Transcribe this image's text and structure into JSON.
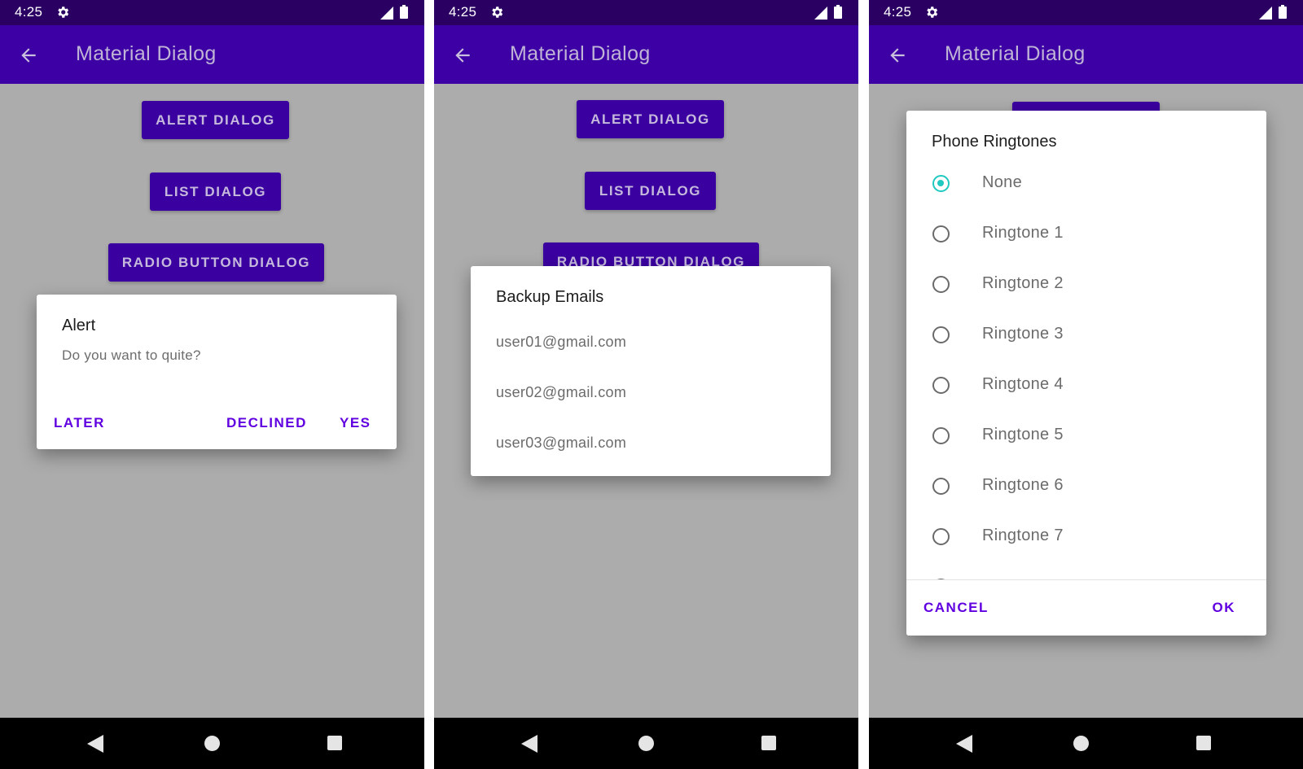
{
  "status_bar": {
    "time": "4:25"
  },
  "app_bar": {
    "title": "Material Dialog"
  },
  "buttons": {
    "alert": "ALERT DIALOG",
    "list": "LIST DIALOG",
    "radio": "RADIO BUTTON DIALOG"
  },
  "alert_dialog": {
    "title": "Alert",
    "message": "Do you want to quite?",
    "actions": {
      "later": "LATER",
      "declined": "DECLINED",
      "yes": "YES"
    }
  },
  "list_dialog": {
    "title": "Backup Emails",
    "items": [
      "user01@gmail.com",
      "user02@gmail.com",
      "user03@gmail.com"
    ]
  },
  "radio_dialog": {
    "title": "Phone Ringtones",
    "options": [
      "None",
      "Ringtone 1",
      "Ringtone 2",
      "Ringtone 3",
      "Ringtone 4",
      "Ringtone 5",
      "Ringtone 6",
      "Ringtone 7"
    ],
    "selected": "None",
    "actions": {
      "cancel": "CANCEL",
      "ok": "OK"
    }
  },
  "colors": {
    "status_bar": "#2b0063",
    "app_bar": "#3d00a5",
    "button": "#3b00a0",
    "accent_text": "#6000e0",
    "radio_checked": "#20c9c0",
    "scrim_background": "#acacac"
  },
  "icons": {
    "status": [
      "gear-icon",
      "signal-icon",
      "battery-icon"
    ],
    "app_bar": "back-arrow-icon",
    "nav": [
      "nav-back-icon",
      "nav-home-icon",
      "nav-recents-icon"
    ]
  }
}
